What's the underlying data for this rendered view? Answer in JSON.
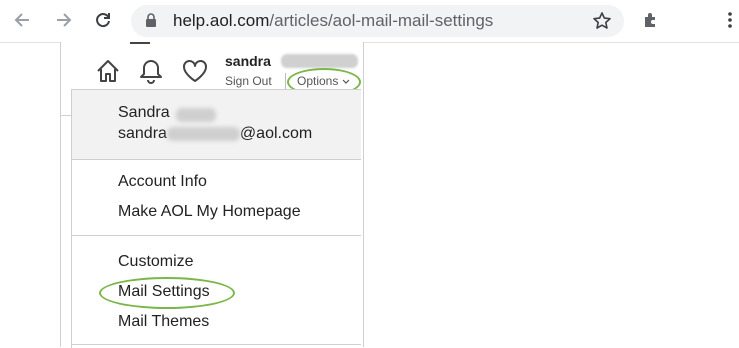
{
  "browser": {
    "url_host": "help.aol.com",
    "url_path": "/articles/aol-mail-mail-settings",
    "icons": [
      "back-arrow-icon",
      "forward-arrow-icon",
      "reload-icon",
      "lock-icon",
      "star-icon",
      "extensions-icon",
      "more-vert-icon"
    ]
  },
  "aol_header": {
    "username": "sandra",
    "sign_out_label": "Sign Out",
    "options_label": "Options",
    "icons": [
      "home-icon",
      "bell-icon",
      "heart-icon"
    ],
    "highlight_color": "#7ab648"
  },
  "menu": {
    "name": "Sandra",
    "email_prefix": "sandra",
    "email_suffix": "@aol.com",
    "items": [
      {
        "label": "Account Info"
      },
      {
        "label": "Make AOL My Homepage"
      },
      {
        "label": "Customize"
      },
      {
        "label": "Mail Settings"
      },
      {
        "label": "Mail Themes"
      }
    ]
  }
}
